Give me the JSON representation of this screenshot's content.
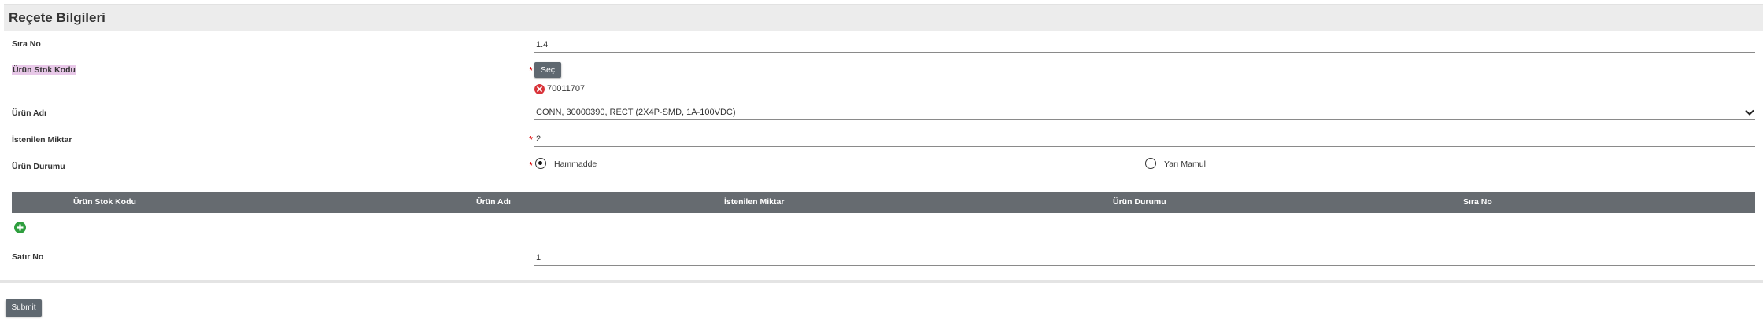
{
  "panel": {
    "title": "Reçete Bilgileri"
  },
  "fields": {
    "sira_no": {
      "label": "Sıra No",
      "value": "1.4"
    },
    "urun_stok_kodu": {
      "label": "Ürün Stok Kodu",
      "button_label": "Seç",
      "selected_code": "70011707"
    },
    "urun_adi": {
      "label": "Ürün Adı",
      "value": "CONN, 30000390, RECT (2X4P-SMD, 1A-100VDC)"
    },
    "istenilen_miktar": {
      "label": "İstenilen Miktar",
      "value": "2"
    },
    "urun_durumu": {
      "label": "Ürün Durumu",
      "options": [
        {
          "label": "Hammadde",
          "selected": true
        },
        {
          "label": "Yarı Mamul",
          "selected": false
        }
      ]
    }
  },
  "required_marker": "*",
  "table": {
    "columns": [
      "Ürün Stok Kodu",
      "Ürün Adı",
      "İstenilen Miktar",
      "Ürün Durumu",
      "Sıra No"
    ]
  },
  "icons": {
    "remove": "x-circle-icon",
    "add": "plus-circle-icon",
    "dropdown": "chevron-down-icon"
  },
  "satir_no": {
    "label": "Satır No",
    "value": "1"
  },
  "submit_label": "Submit",
  "colors": {
    "button": "#5f6870",
    "table_header": "#666b70",
    "remove_icon": "#d9343a",
    "add_icon": "#2e9e3e",
    "required": "#dd0000"
  }
}
